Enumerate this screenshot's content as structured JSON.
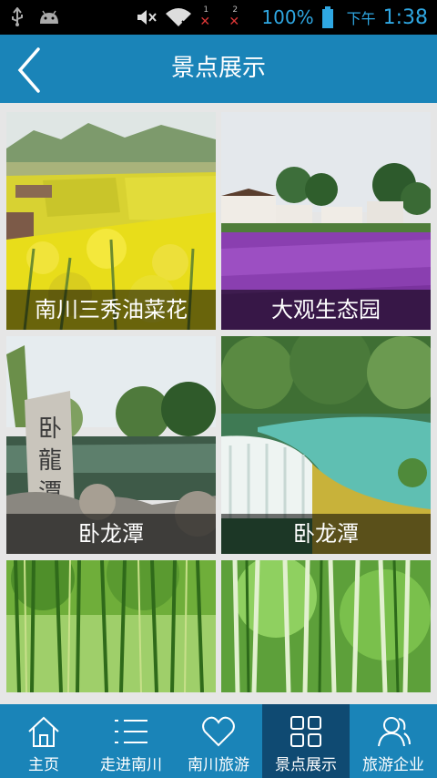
{
  "status_bar": {
    "battery_percent": "100%",
    "period": "下午",
    "time": "1:38",
    "sim1": "1",
    "sim2": "2",
    "icons": [
      "usb-icon",
      "android-icon",
      "mute-icon",
      "wifi-icon",
      "sim-no-signal-icon",
      "battery-icon"
    ]
  },
  "header": {
    "title": "景点展示",
    "back_icon": "chevron-left-icon"
  },
  "tiles": [
    {
      "caption": "南川三秀油菜花"
    },
    {
      "caption": "大观生态园"
    },
    {
      "caption": "卧龙潭"
    },
    {
      "caption": "卧龙潭"
    },
    {
      "caption": ""
    },
    {
      "caption": ""
    }
  ],
  "nav": {
    "items": [
      {
        "label": "主页",
        "icon": "home-icon"
      },
      {
        "label": "走进南川",
        "icon": "list-icon"
      },
      {
        "label": "南川旅游",
        "icon": "heart-icon"
      },
      {
        "label": "景点展示",
        "icon": "grid-icon",
        "active": true
      },
      {
        "label": "旅游企业",
        "icon": "users-icon"
      }
    ]
  },
  "colors": {
    "header_bg": "#1a84b8",
    "nav_active_bg": "#0f4a72",
    "status_text": "#2fa7e2"
  }
}
